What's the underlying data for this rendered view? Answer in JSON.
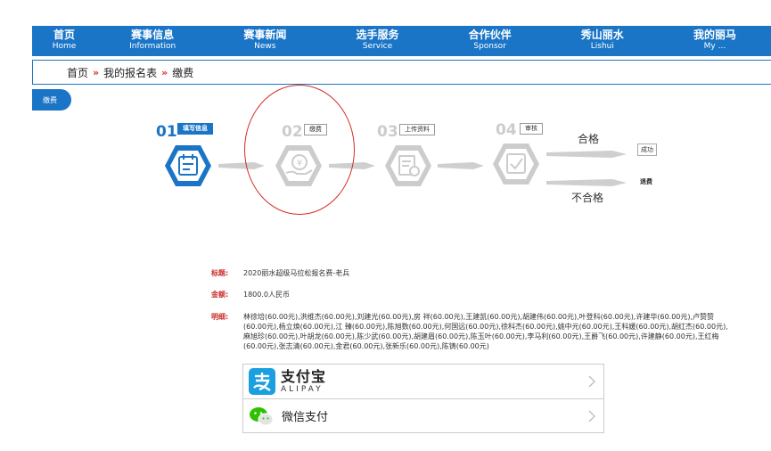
{
  "nav": [
    {
      "zh": "首页",
      "en": "Home"
    },
    {
      "zh": "赛事信息",
      "en": "Information"
    },
    {
      "zh": "赛事新闻",
      "en": "News"
    },
    {
      "zh": "选手服务",
      "en": "Service"
    },
    {
      "zh": "合作伙伴",
      "en": "Sponsor"
    },
    {
      "zh": "秀山丽水",
      "en": "Lishui"
    },
    {
      "zh": "我的丽马",
      "en": "My ..."
    }
  ],
  "breadcrumb": {
    "home": "首页",
    "sep": "»",
    "registrations": "我的报名表",
    "current": "缴费"
  },
  "side_tag": "缴费",
  "steps": [
    {
      "num": "01",
      "label": "填写信息"
    },
    {
      "num": "02",
      "label": "缴费"
    },
    {
      "num": "03",
      "label": "上传资料"
    },
    {
      "num": "04",
      "label": "审核"
    }
  ],
  "result": {
    "pass": "合格",
    "success": "成功",
    "fail": "不合格",
    "refund": "退费"
  },
  "info": {
    "title_label": "标题:",
    "title_value": "2020丽水超级马拉松报名费-老兵",
    "amount_label": "金额:",
    "amount_value": "1800.0人民币",
    "detail_label": "明细:",
    "detail_value": "林徐培(60.00元),洪维杰(60.00元),刘建光(60.00元),房 祥(60.00元),王建凯(60.00元),胡建伟(60.00元),叶登科(60.00元),许建华(60.00元),卢赞赞(60.00元),杨立焕(60.00元),江 臻(60.00元),陈旭数(60.00元),何国远(60.00元),徐科杰(60.00元),姚中元(60.00元),王科媛(60.00元),胡红杰(60.00元),麻旭珍(60.00元),叶胡龙(60.00元),陈少武(60.00元),胡建眉(60.00元),陈玉叶(60.00元),李马利(60.00元),王爵飞(60.00元),许建静(60.00元),王红梅(60.00元),张志清(60.00元),金君(60.00元),张新乐(60.00元),陈铸(60.00元)"
  },
  "payment": {
    "alipay_zh": "支付宝",
    "alipay_en": "ALIPAY",
    "wechat": "微信支付"
  },
  "colors": {
    "primary": "#1a75c7",
    "accent_red": "#d42d26",
    "inactive": "#cccccc"
  }
}
